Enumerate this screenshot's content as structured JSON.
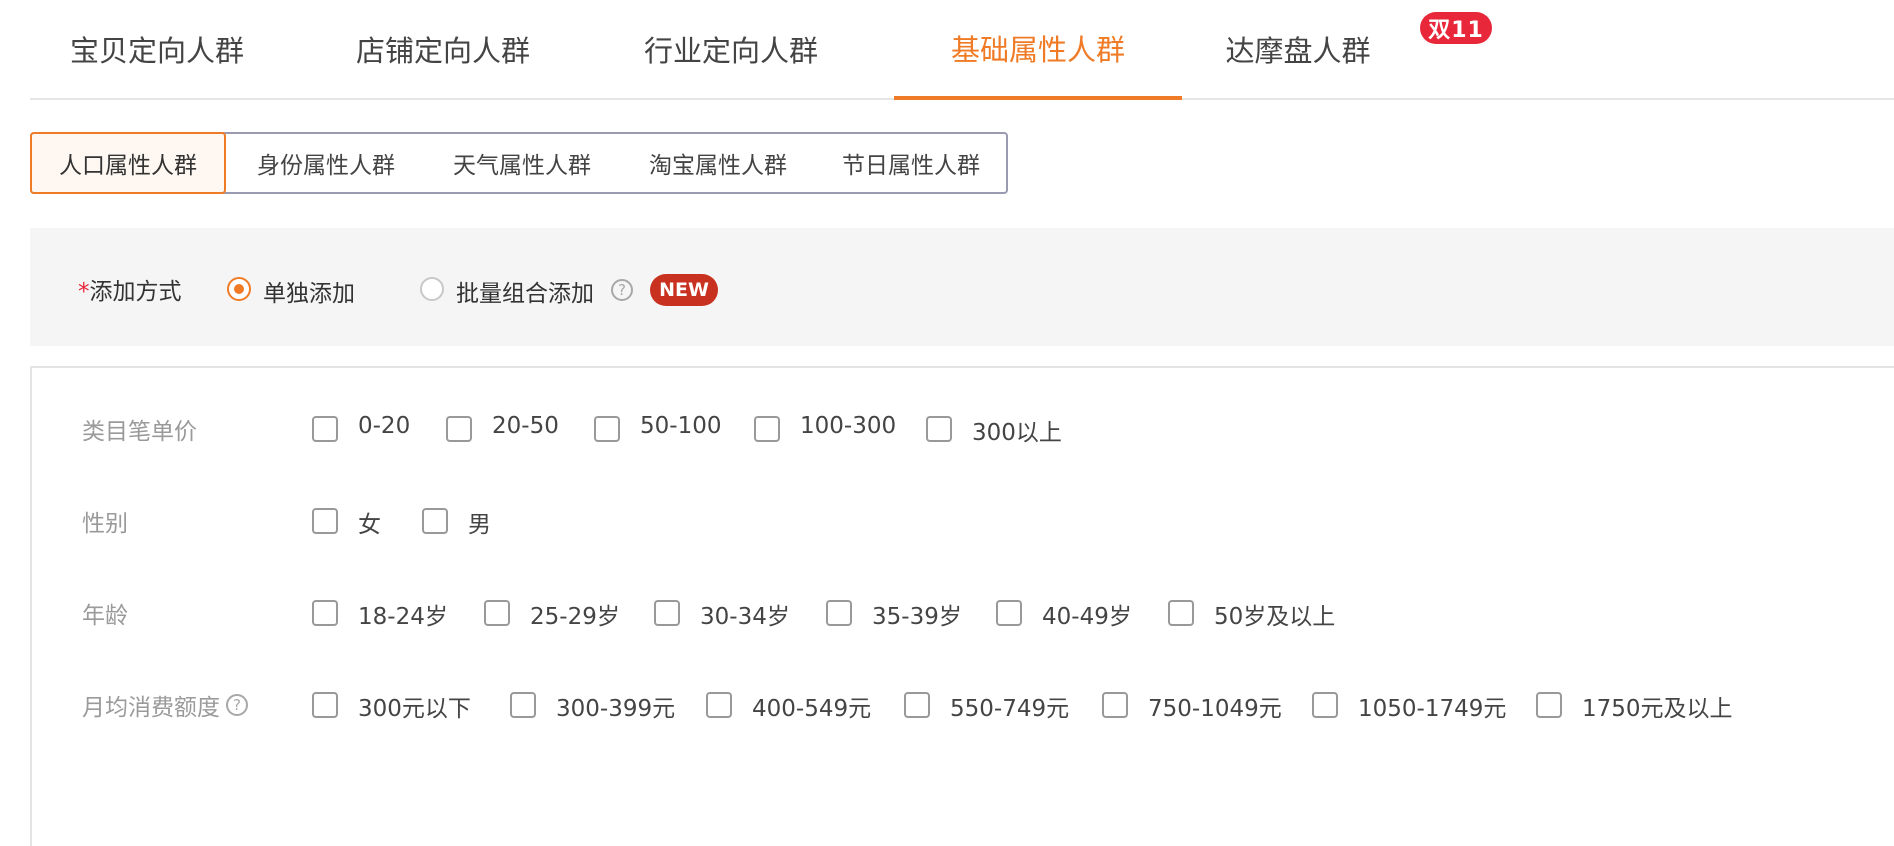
{
  "top_tabs": [
    {
      "label": "宝贝定向人群"
    },
    {
      "label": "店铺定向人群"
    },
    {
      "label": "行业定向人群"
    },
    {
      "label": "基础属性人群"
    },
    {
      "label": "达摩盘人群"
    }
  ],
  "top_tab_badge": "双11",
  "sub_tabs": [
    {
      "label": "人口属性人群"
    },
    {
      "label": "身份属性人群"
    },
    {
      "label": "天气属性人群"
    },
    {
      "label": "淘宝属性人群"
    },
    {
      "label": "节日属性人群"
    }
  ],
  "add_method": {
    "required_mark": "*",
    "label": "添加方式",
    "options": [
      {
        "label": "单独添加",
        "checked": true
      },
      {
        "label": "批量组合添加",
        "checked": false
      }
    ],
    "help_glyph": "?",
    "new_badge": "NEW"
  },
  "filters": {
    "price": {
      "label": "类目笔单价",
      "options": [
        "0-20",
        "20-50",
        "50-100",
        "100-300",
        "300以上"
      ]
    },
    "gender": {
      "label": "性别",
      "options": [
        "女",
        "男"
      ]
    },
    "age": {
      "label": "年龄",
      "options": [
        "18-24岁",
        "25-29岁",
        "30-34岁",
        "35-39岁",
        "40-49岁",
        "50岁及以上"
      ]
    },
    "spend": {
      "label": "月均消费额度",
      "help_glyph": "?",
      "options": [
        "300元以下",
        "300-399元",
        "400-549元",
        "550-749元",
        "750-1049元",
        "1050-1749元",
        "1750元及以上"
      ]
    }
  },
  "colors": {
    "accent": "#f07b26",
    "badge_red": "#e8273a",
    "new_red": "#c8311f"
  }
}
